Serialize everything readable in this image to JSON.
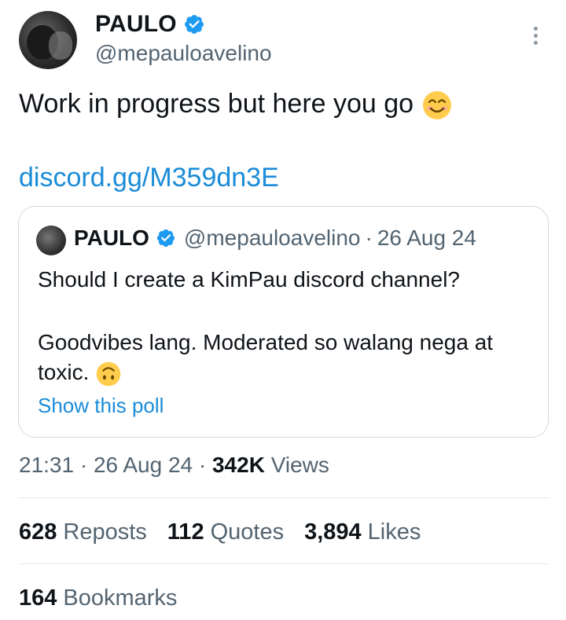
{
  "author": {
    "name": "PAULO",
    "handle": "@mepauloavelino"
  },
  "tweet": {
    "text": "Work in progress but here you go",
    "emoji": "smiling-face-emoji",
    "link": "discord.gg/M359dn3E"
  },
  "quote": {
    "name": "PAULO",
    "handle": "@mepauloavelino",
    "separator": "·",
    "date": "26 Aug 24",
    "line1": "Should I create a KimPau discord channel?",
    "line2": "Goodvibes lang. Moderated so walang nega at toxic.",
    "emoji": "upside-down-face-emoji",
    "poll_link": "Show this poll"
  },
  "meta": {
    "time": "21:31",
    "sep1": "·",
    "date": "26 Aug 24",
    "sep2": "·",
    "views_count": "342K",
    "views_label": "Views"
  },
  "stats": {
    "reposts_count": "628",
    "reposts_label": "Reposts",
    "quotes_count": "112",
    "quotes_label": "Quotes",
    "likes_count": "3,894",
    "likes_label": "Likes",
    "bookmarks_count": "164",
    "bookmarks_label": "Bookmarks"
  },
  "colors": {
    "link": "#1a8cd8",
    "verified": "#1d9bf0",
    "muted": "#536471"
  }
}
